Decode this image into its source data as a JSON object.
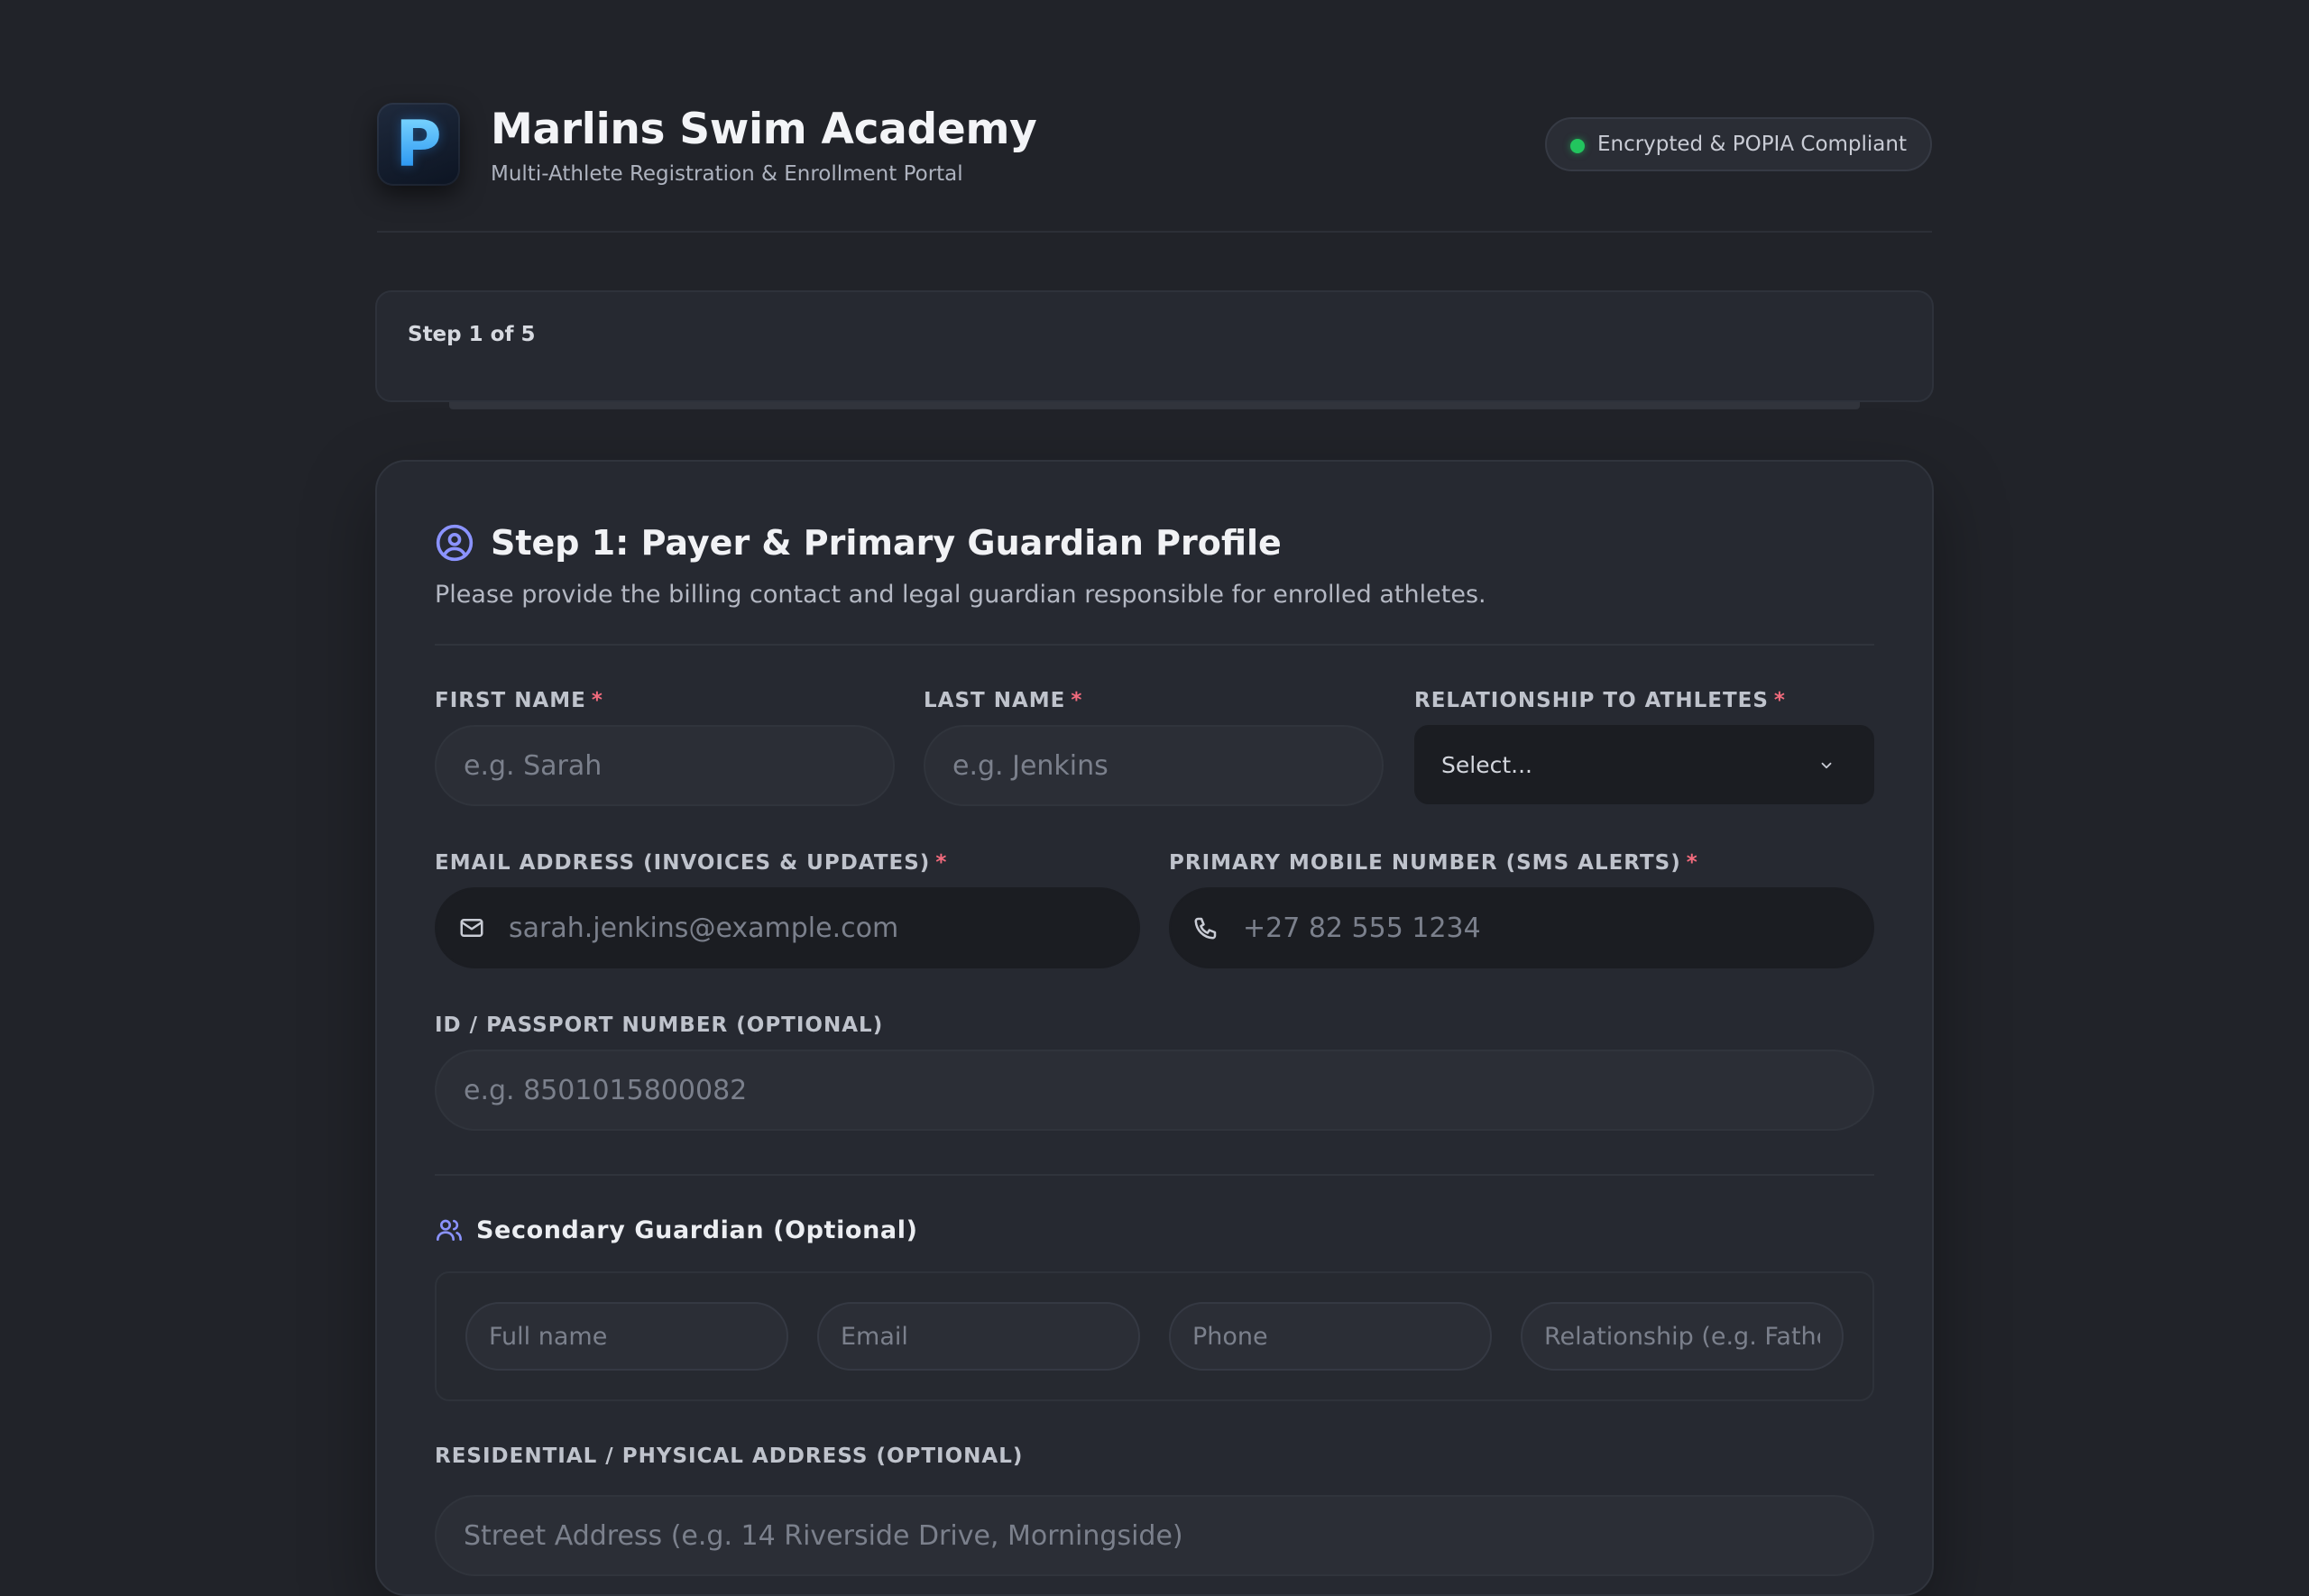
{
  "app": {
    "logo_letter": "P",
    "title": "Marlins Swim Academy",
    "subtitle": "Multi-Athlete Registration & Enrollment Portal",
    "security_badge": "Encrypted & POPIA Compliant",
    "badge_color": "#22c55e"
  },
  "progress": {
    "step_label": "Step 1 of 5"
  },
  "section": {
    "icon": "user-circle-icon",
    "title": "Step 1: Payer & Primary Guardian Profile",
    "description": "Please provide the billing contact and legal guardian responsible for enrolled athletes."
  },
  "fields": {
    "first_name": {
      "label": "First Name",
      "required": "*",
      "placeholder": "e.g. Sarah"
    },
    "last_name": {
      "label": "Last Name",
      "required": "*",
      "placeholder": "e.g. Jenkins"
    },
    "relationship": {
      "label": "Relationship to Athletes",
      "required": "*",
      "value": "Select..."
    },
    "email": {
      "label": "Email Address (Invoices & Updates)",
      "required": "*",
      "placeholder": "sarah.jenkins@example.com",
      "icon": "mail-icon"
    },
    "mobile": {
      "label": "Primary Mobile Number (SMS Alerts)",
      "required": "*",
      "placeholder": "+27 82 555 1234",
      "icon": "phone-icon"
    },
    "id_number": {
      "label": "ID / Passport Number (Optional)",
      "placeholder": "e.g. 8501015800082"
    },
    "address": {
      "label": "Residential / Physical Address (Optional)",
      "placeholder": "Street Address (e.g. 14 Riverside Drive, Morningside)"
    }
  },
  "secondary_guardian": {
    "icon": "users-icon",
    "title": "Secondary Guardian (Optional)",
    "name_placeholder": "Full name",
    "email_placeholder": "Email",
    "phone_placeholder": "Phone",
    "relationship_placeholder": "Relationship (e.g. Father"
  },
  "colors": {
    "accent": "#8b93ff",
    "required": "#f26b7d",
    "background": "#212329",
    "card": "#262931"
  }
}
